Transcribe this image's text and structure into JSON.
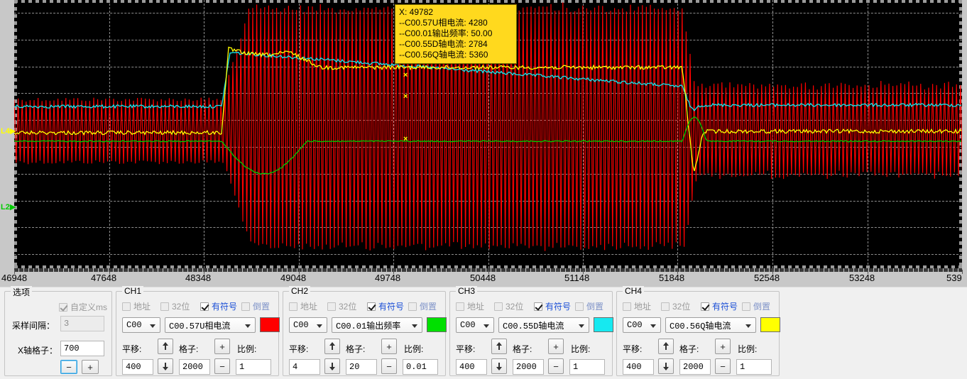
{
  "tooltip": {
    "x_label": "X: 49782",
    "lines": [
      "--C00.57U相电流: 4280",
      "--C00.01输出频率: 50.00",
      "--C00.55D轴电流: 2784",
      "--C00.56Q轴电流: 5360"
    ]
  },
  "cursor_labels": [
    {
      "name": "L4",
      "text": "L4▶",
      "color": "#ffff00",
      "y": 180
    },
    {
      "name": "L2",
      "text": "L2▶",
      "color": "#00cc00",
      "y": 287
    }
  ],
  "xaxis": {
    "ticks": [
      "46948",
      "47648",
      "48348",
      "49048",
      "49748",
      "50448",
      "51148",
      "51848",
      "52548",
      "53248",
      "539"
    ],
    "start": 46948,
    "step": 700
  },
  "options": {
    "caption": "选项",
    "custom_ms_label": "自定义ms",
    "custom_ms_checked": true,
    "sample_interval_label": "采样间隔：",
    "sample_interval_value": "3",
    "x_grid_label": "X轴格子：",
    "x_grid_value": "700",
    "minus_label": "−",
    "plus_label": "+"
  },
  "channel_common": {
    "addr_label": "地址",
    "bit32_label": "32位",
    "signed_label": "有符号",
    "invert_label": "倒置",
    "shift_label": "平移:",
    "grid_label": "格子:",
    "scale_label": "比例:",
    "plus_label": "+",
    "minus_label": "−"
  },
  "channels": [
    {
      "caption": "CH1",
      "addr_checked": false,
      "bit32_checked": false,
      "signed_checked": true,
      "invert_checked": false,
      "group_value": "C00",
      "signal_value": "C00.57U相电流",
      "color": "#ff0000",
      "shift_value": "400",
      "grid_value": "2000",
      "scale_value": "1"
    },
    {
      "caption": "CH2",
      "addr_checked": false,
      "bit32_checked": false,
      "signed_checked": true,
      "invert_checked": false,
      "group_value": "C00",
      "signal_value": "C00.01输出频率",
      "color": "#00e000",
      "shift_value": "4",
      "grid_value": "20",
      "scale_value": "0.01"
    },
    {
      "caption": "CH3",
      "addr_checked": false,
      "bit32_checked": false,
      "signed_checked": true,
      "invert_checked": false,
      "group_value": "C00",
      "signal_value": "C00.55D轴电流",
      "color": "#16e9f0",
      "shift_value": "400",
      "grid_value": "2000",
      "scale_value": "1"
    },
    {
      "caption": "CH4",
      "addr_checked": false,
      "bit32_checked": false,
      "signed_checked": true,
      "invert_checked": false,
      "group_value": "C00",
      "signal_value": "C00.56Q轴电流",
      "color": "#ffff00",
      "shift_value": "400",
      "grid_value": "2000",
      "scale_value": "1"
    }
  ],
  "chart_data": {
    "type": "line",
    "title": "",
    "xlabel": "",
    "ylabel": "",
    "background": "#000000",
    "grid": true,
    "legend": "none",
    "xlim": [
      46948,
      53948
    ],
    "x_tick_step": 700,
    "series": [
      {
        "name": "C00.57U相电流",
        "color": "#ff0000",
        "cursor_value": 4280,
        "description": "high-frequency AC phase current, dense oscillation; small amplitude before t=48348, very large amplitude burst between t=48400 and t=51900, then medium amplitude"
      },
      {
        "name": "C00.01输出频率",
        "color": "#00e000",
        "cursor_value": 50.0,
        "description": "output frequency, flat baseline then dip down between t=48400-49100, recovers flat, brief bump at t=51900"
      },
      {
        "name": "C00.55D轴电流",
        "color": "#16e9f0",
        "cursor_value": 2784,
        "description": "D-axis current, flat low then step up at t=48400 decaying gradually, drops back at t=51900"
      },
      {
        "name": "C00.56Q轴电流",
        "color": "#ffff00",
        "cursor_value": 5360,
        "description": "Q-axis current, flat then large step up at t=48400 with slow decay, falls with undershoot at t=51900"
      }
    ]
  }
}
